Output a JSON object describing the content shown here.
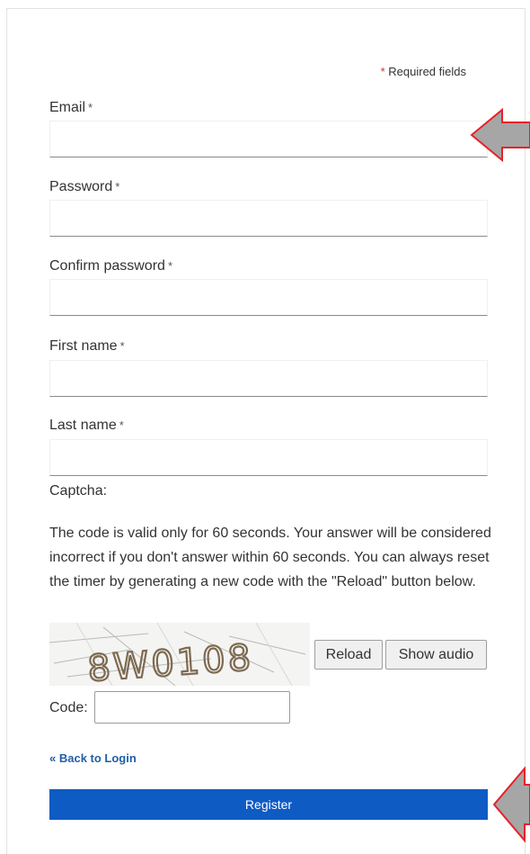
{
  "form": {
    "required_note": {
      "star": "*",
      "text": "Required fields"
    },
    "fields": [
      {
        "label": "Email",
        "star": "*",
        "value": ""
      },
      {
        "label": "Password",
        "star": "*",
        "value": ""
      },
      {
        "label": "Confirm password",
        "star": "*",
        "value": ""
      },
      {
        "label": "First name",
        "star": "*",
        "value": ""
      },
      {
        "label": "Last name",
        "star": "*",
        "value": ""
      }
    ],
    "captcha": {
      "title": "Captcha:",
      "instructions": "The code is valid only for 60 seconds. Your answer will be considered incorrect if you don't answer within 60 seconds. You can always reset the timer by generating a new code with the \"Reload\" button below.",
      "image_text": "8W0108",
      "reload_label": "Reload",
      "audio_label": "Show audio",
      "code_label": "Code:",
      "code_value": ""
    },
    "back_link": "« Back to Login",
    "register_label": "Register"
  },
  "colors": {
    "accent": "#0f5bc4",
    "link": "#1f5fa8",
    "required_star": "#c0392b",
    "annotation_arrow_fill": "#a6a6a6",
    "annotation_arrow_stroke": "#e8202a"
  }
}
